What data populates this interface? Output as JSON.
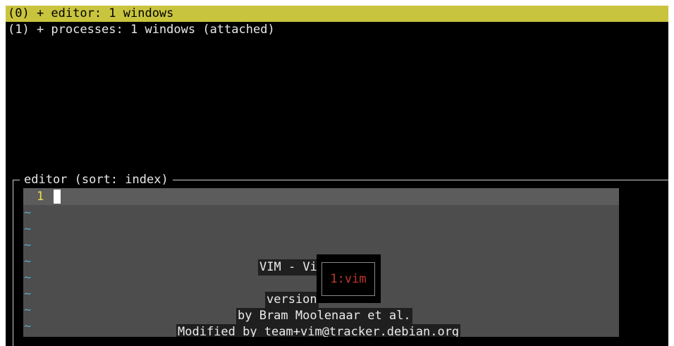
{
  "sessions": [
    {
      "label": "(0) + editor: 1 windows",
      "selected": true
    },
    {
      "label": "(1) + processes: 1 windows (attached)",
      "selected": false
    }
  ],
  "pane": {
    "title": "editor (sort: index)",
    "line_number": "1",
    "tilde": "~",
    "intro": [
      "VIM - Vi",
      "version",
      "by Bram Moolenaar et al.",
      "Modified by team+vim@tracker.debian.org"
    ]
  },
  "popup": {
    "label": "1:vim"
  },
  "colors": {
    "selection": "#c9c43e",
    "line_number": "#f0e04a",
    "tilde": "#5aa7c4",
    "popup_text": "#c0392b"
  }
}
